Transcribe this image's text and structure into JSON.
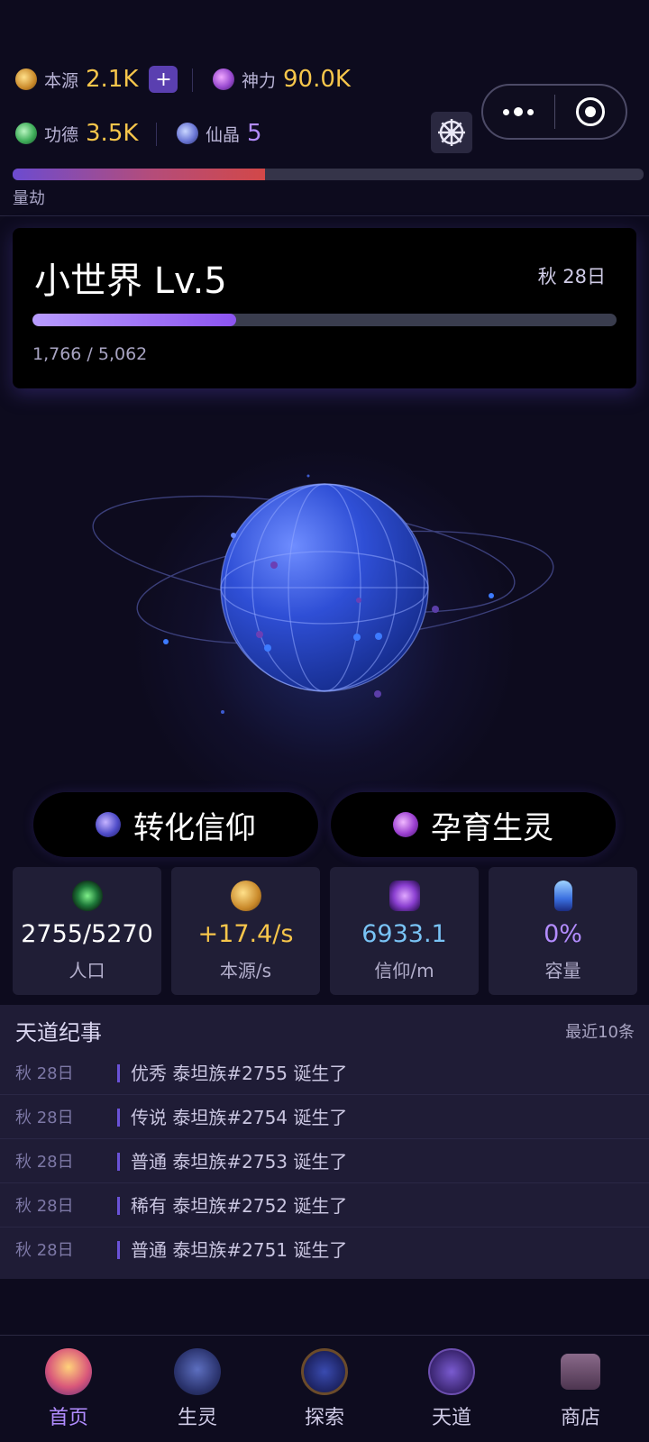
{
  "resources": {
    "benyuan": {
      "label": "本源",
      "value": "2.1K"
    },
    "plus": "+",
    "shenli": {
      "label": "神力",
      "value": "90.0K"
    },
    "gongde": {
      "label": "功德",
      "value": "3.5K"
    },
    "xianjing": {
      "label": "仙晶",
      "value": "5"
    }
  },
  "kalpa": {
    "label": "量劫",
    "progress": 0.4
  },
  "world": {
    "title": "小世界 Lv.5",
    "season": "秋 28日",
    "xp_text": "1,766 / 5,062",
    "xp_current": 1766,
    "xp_max": 5062
  },
  "actions": {
    "convert": "转化信仰",
    "breed": "孕育生灵"
  },
  "stats": [
    {
      "value": "2755/5270",
      "label": "人口",
      "color": "#ffffff",
      "icon": "population-icon"
    },
    {
      "value": "+17.4/s",
      "label": "本源/s",
      "color": "#f7c64b",
      "icon": "origin-icon"
    },
    {
      "value": "6933.1",
      "label": "信仰/m",
      "color": "#79c3f5",
      "icon": "faith-icon"
    },
    {
      "value": "0%",
      "label": "容量",
      "color": "#b38cff",
      "icon": "capacity-icon"
    }
  ],
  "chronicle": {
    "title": "天道纪事",
    "count": "最近10条",
    "entries": [
      {
        "date": "秋 28日",
        "text": "优秀 泰坦族#2755 诞生了"
      },
      {
        "date": "秋 28日",
        "text": "传说 泰坦族#2754 诞生了"
      },
      {
        "date": "秋 28日",
        "text": "普通 泰坦族#2753 诞生了"
      },
      {
        "date": "秋 28日",
        "text": "稀有 泰坦族#2752 诞生了"
      },
      {
        "date": "秋 28日",
        "text": "普通 泰坦族#2751 诞生了"
      }
    ]
  },
  "nav": [
    {
      "label": "首页",
      "icon": "palace-icon",
      "active": true
    },
    {
      "label": "生灵",
      "icon": "dragon-icon",
      "active": false
    },
    {
      "label": "探索",
      "icon": "compass-icon",
      "active": false
    },
    {
      "label": "天道",
      "icon": "taiji-icon",
      "active": false
    },
    {
      "label": "商店",
      "icon": "treasure-chest-icon",
      "active": false
    }
  ],
  "colors": {
    "background": "#0d0b1e",
    "gold": "#f7c64b",
    "purple_accent": "#b18cff",
    "card": "#201e36"
  }
}
